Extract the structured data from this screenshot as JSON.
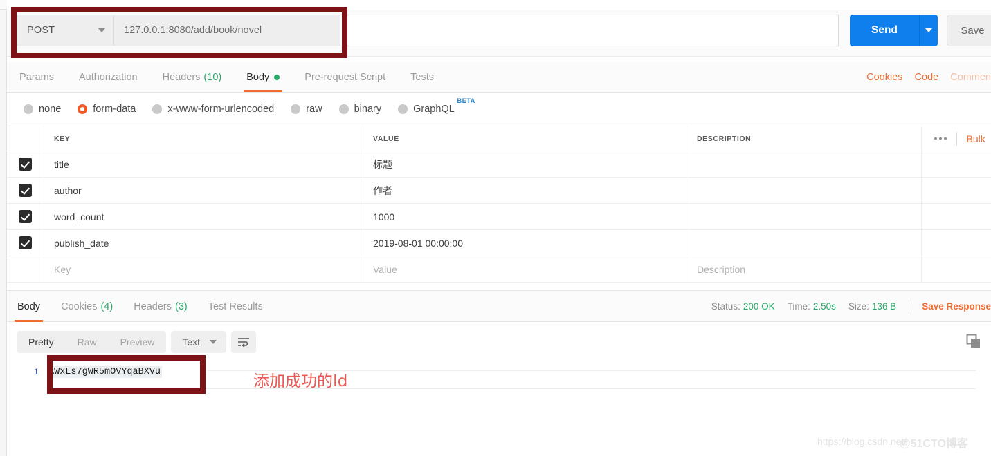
{
  "request": {
    "method": "POST",
    "url": "127.0.0.1:8080/add/book/novel",
    "send_label": "Send",
    "save_label": "Save",
    "tabs": [
      {
        "label": "Params",
        "count": "",
        "active": false,
        "dot": false
      },
      {
        "label": "Authorization",
        "count": "",
        "active": false,
        "dot": false
      },
      {
        "label": "Headers",
        "count": "(10)",
        "active": false,
        "dot": false
      },
      {
        "label": "Body",
        "count": "",
        "active": true,
        "dot": true
      },
      {
        "label": "Pre-request Script",
        "count": "",
        "active": false,
        "dot": false
      },
      {
        "label": "Tests",
        "count": "",
        "active": false,
        "dot": false
      }
    ],
    "right_links": [
      {
        "label": "Cookies",
        "style": "orange"
      },
      {
        "label": "Code",
        "style": "orange"
      },
      {
        "label": "Commen",
        "style": "faded"
      }
    ],
    "body_types": [
      {
        "label": "none",
        "selected": false,
        "beta": false
      },
      {
        "label": "form-data",
        "selected": true,
        "beta": false
      },
      {
        "label": "x-www-form-urlencoded",
        "selected": false,
        "beta": false
      },
      {
        "label": "raw",
        "selected": false,
        "beta": false
      },
      {
        "label": "binary",
        "selected": false,
        "beta": false
      },
      {
        "label": "GraphQL",
        "selected": false,
        "beta": true
      }
    ],
    "beta_badge": "BETA"
  },
  "table": {
    "headers": {
      "key": "KEY",
      "value": "VALUE",
      "description": "DESCRIPTION"
    },
    "bulk_label": "Bulk",
    "rows": [
      {
        "checked": true,
        "key": "title",
        "value": "标题",
        "description": ""
      },
      {
        "checked": true,
        "key": "author",
        "value": "作者",
        "description": ""
      },
      {
        "checked": true,
        "key": "word_count",
        "value": "1000",
        "description": ""
      },
      {
        "checked": true,
        "key": "publish_date",
        "value": "2019-08-01 00:00:00",
        "description": ""
      }
    ],
    "placeholder_row": {
      "key": "Key",
      "value": "Value",
      "description": "Description"
    }
  },
  "response": {
    "tabs": [
      {
        "label": "Body",
        "count": "",
        "active": true
      },
      {
        "label": "Cookies",
        "count": "(4)",
        "active": false
      },
      {
        "label": "Headers",
        "count": "(3)",
        "active": false
      },
      {
        "label": "Test Results",
        "count": "",
        "active": false
      }
    ],
    "meta": {
      "status_label": "Status:",
      "status_value": "200 OK",
      "time_label": "Time:",
      "time_value": "2.50s",
      "size_label": "Size:",
      "size_value": "136 B",
      "save_response": "Save Response"
    },
    "view_modes": [
      {
        "label": "Pretty",
        "active": true
      },
      {
        "label": "Raw",
        "active": false
      },
      {
        "label": "Preview",
        "active": false
      }
    ],
    "format": "Text",
    "line_number": "1",
    "body_text": "AWxLs7gWR5mOVYqaBXVu"
  },
  "annotation": {
    "note": "添加成功的Id",
    "box_color": "#7d1316",
    "note_color": "#ea5a54"
  },
  "watermark": {
    "url": "https://blog.csdn.net/",
    "brand": "@51CTO博客"
  },
  "colors": {
    "accent_orange": "#ef6c32",
    "send_blue": "#0f7fee",
    "green": "#2aa86a",
    "beta_blue": "#2e8bd0"
  }
}
